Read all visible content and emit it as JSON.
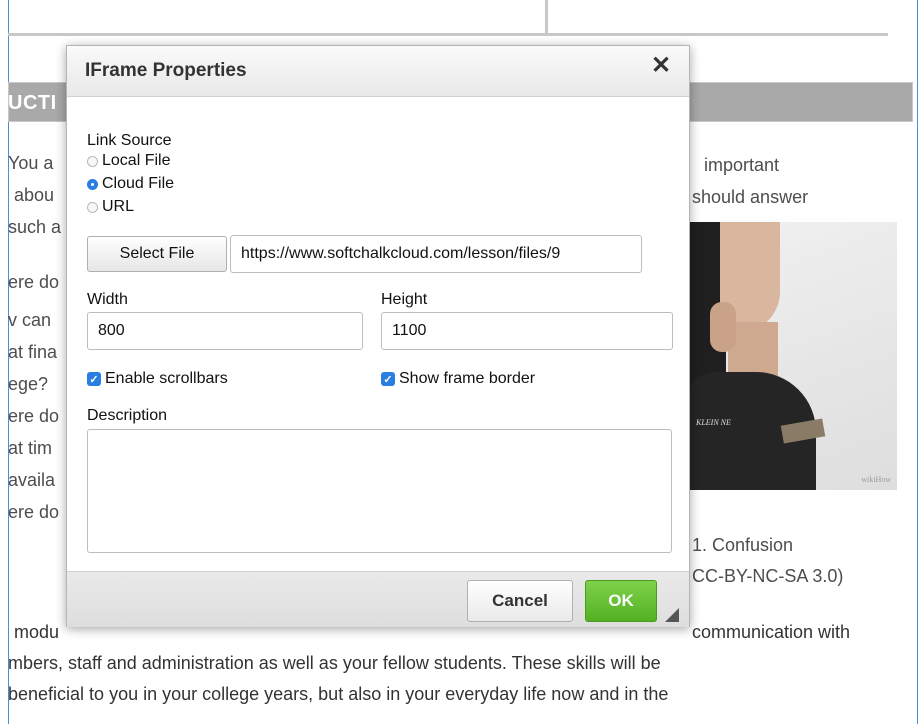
{
  "background": {
    "section_title": "UCTI",
    "left_fragments": [
      "You a",
      "abou",
      "such a",
      "ere do",
      "v can",
      "at fina",
      "ege?",
      "ere do",
      "at tim",
      "availa",
      "ere do"
    ],
    "right_lines": [
      "important",
      "should answer"
    ],
    "caption_lines": [
      "1. Confusion",
      "CC-BY-NC-SA 3.0)"
    ],
    "bottom_lines": [
      "modu",
      "communication with",
      "mbers, staff and administration as well as your fellow students. These skills will be",
      "beneficial to you in your college years, but also in your everyday life now and in the"
    ],
    "photo": {
      "shirt_text": "KLEIN NE",
      "watermark": "wikiHow"
    }
  },
  "dialog": {
    "title": "IFrame Properties",
    "close_label": "✕",
    "link_source": {
      "label": "Link Source",
      "options": [
        {
          "label": "Local File",
          "checked": false
        },
        {
          "label": "Cloud File",
          "checked": true
        },
        {
          "label": "URL",
          "checked": false
        }
      ]
    },
    "select_file_label": "Select File",
    "url_value": "https://www.softchalkcloud.com/lesson/files/9",
    "width": {
      "label": "Width",
      "value": "800"
    },
    "height": {
      "label": "Height",
      "value": "1100"
    },
    "enable_scrollbars": {
      "label": "Enable scrollbars",
      "checked": true
    },
    "show_frame_border": {
      "label": "Show frame border",
      "checked": true
    },
    "description": {
      "label": "Description",
      "value": ""
    },
    "cancel_label": "Cancel",
    "ok_label": "OK"
  },
  "colors": {
    "accent": "#2a7de1",
    "ok_green": "#5cb82a",
    "section_bar": "#a9a9a9"
  }
}
